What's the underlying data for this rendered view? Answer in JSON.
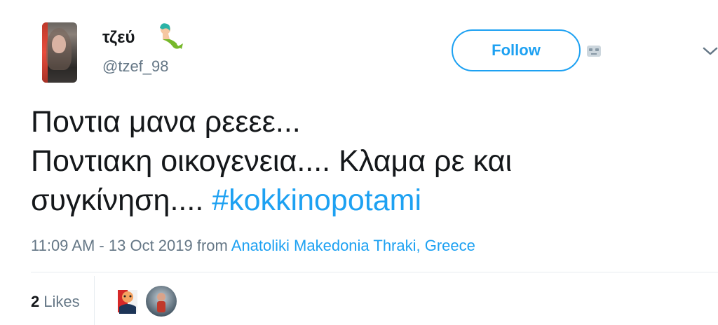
{
  "user": {
    "name": "τζεύ",
    "handle": "@tzef_98",
    "emoji": "mermaid-icon"
  },
  "actions": {
    "follow_label": "Follow"
  },
  "tweet": {
    "lines": [
      "Ποντια μανα ρεεεε...",
      "Ποντιακη οικογενεια.... Κλαμα ρε και",
      "συγκίνηση...."
    ],
    "hashtag": "#kokkinopotami"
  },
  "meta": {
    "timestamp": "11:09 AM - 13 Oct 2019",
    "from": "from",
    "location": "Anatoliki Makedonia Thraki, Greece"
  },
  "engagement": {
    "likes_count": "2",
    "likes_label": "Likes"
  },
  "colors": {
    "accent": "#1da1f2",
    "text": "#14171a",
    "muted": "#657786"
  }
}
